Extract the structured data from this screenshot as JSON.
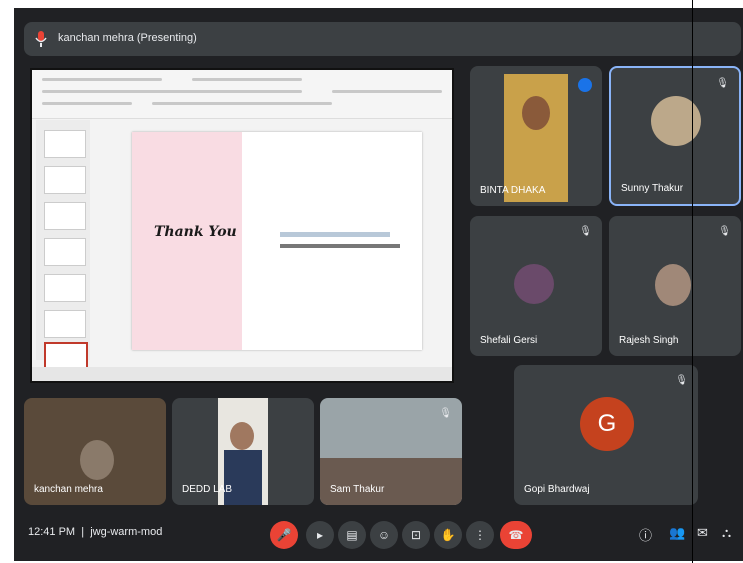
{
  "presenter_bar": {
    "title": "kanchan mehra (Presenting)"
  },
  "participants": {
    "binta": "BINTA DHAKA",
    "sunny": "Sunny Thakur",
    "shefali": "Shefali Gersi",
    "rajesh": "Rajesh Singh",
    "gopi": "Gopi Bhardwaj",
    "gopi_initial": "G",
    "kanchan": "kanchan mehra",
    "dedd": "DEDD LAB",
    "sam": "Sam Thakur"
  },
  "slide": {
    "thank_you": "Thank You"
  },
  "bottom": {
    "time": "12:41 PM",
    "meeting_code": "jwg-warm-mod"
  },
  "colors": {
    "meet_bg": "#202124",
    "tile_bg": "#3c4043",
    "accent_blue": "#8ab4f8",
    "red": "#ea4335",
    "slide_pink": "#f9dce3"
  }
}
